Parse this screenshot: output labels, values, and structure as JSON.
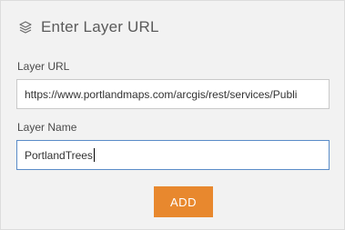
{
  "header": {
    "icon": "layers-icon",
    "title": "Enter Layer URL"
  },
  "layer_url": {
    "label": "Layer URL",
    "value": "https://www.portlandmaps.com/arcgis/rest/services/Publi"
  },
  "layer_name": {
    "label": "Layer Name",
    "value": "PortlandTrees"
  },
  "add_button": {
    "label": "ADD",
    "color": "#e8882e"
  }
}
